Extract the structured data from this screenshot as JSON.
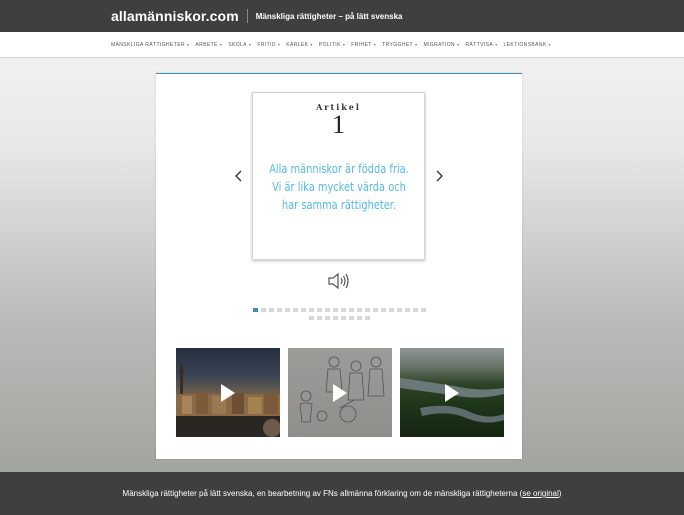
{
  "header": {
    "logo": "allamänniskor.com",
    "tagline": "Mänskliga rättigheter – på lätt svenska"
  },
  "nav": {
    "items": [
      {
        "label": "Mänskliga rättigheter"
      },
      {
        "label": "Arbete"
      },
      {
        "label": "Skola"
      },
      {
        "label": "Fritid"
      },
      {
        "label": "Kärlek"
      },
      {
        "label": "Politik"
      },
      {
        "label": "Frihet"
      },
      {
        "label": "Trygghet"
      },
      {
        "label": "Migration"
      },
      {
        "label": "Rättvisa"
      },
      {
        "label": "Lektionsbank"
      }
    ]
  },
  "carousel": {
    "article_label": "Artikel",
    "article_number": "1",
    "article_text": "Alla människor är födda fria. Vi är lika mycket värda och har samma rättigheter.",
    "active_index": 0,
    "total_slides": 30,
    "accent_color": "#3c8dbc",
    "text_color": "#55b9e6"
  },
  "thumbnails": [
    {
      "name": "stockholm-video"
    },
    {
      "name": "drawing-video"
    },
    {
      "name": "river-landscape-video"
    }
  ],
  "footer": {
    "text": "Mänskliga rättigheter på lätt svenska, en bearbetning av FNs allmänna förklaring om de mänskliga rättigheterna (",
    "link": "se original",
    "suffix": ")"
  }
}
